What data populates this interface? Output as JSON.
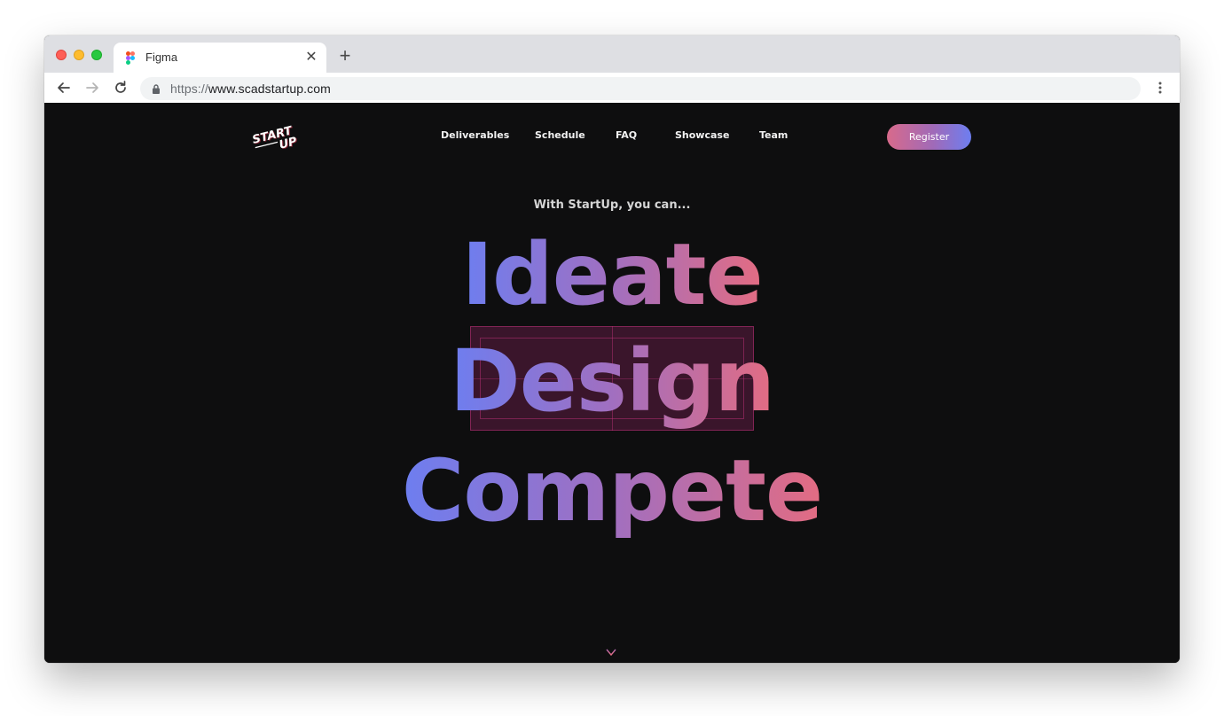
{
  "browser": {
    "tab_title": "Figma",
    "url_scheme": "https://",
    "url_host": "www.scadstartup.com"
  },
  "site": {
    "logo_text_top": "START",
    "logo_text_bottom": "UP",
    "nav": [
      {
        "label": "Deliverables"
      },
      {
        "label": "Schedule"
      },
      {
        "label": "FAQ"
      },
      {
        "label": "Showcase"
      },
      {
        "label": "Team"
      }
    ],
    "register_label": "Register"
  },
  "hero": {
    "tagline": "With StartUp, you can...",
    "words": [
      "Ideate",
      "Design",
      "Compete"
    ]
  },
  "colors": {
    "page_bg": "#0e0e0f",
    "gradient_start": "#6d7ef0",
    "gradient_mid": "#a16fc0",
    "gradient_end": "#e36c82"
  }
}
